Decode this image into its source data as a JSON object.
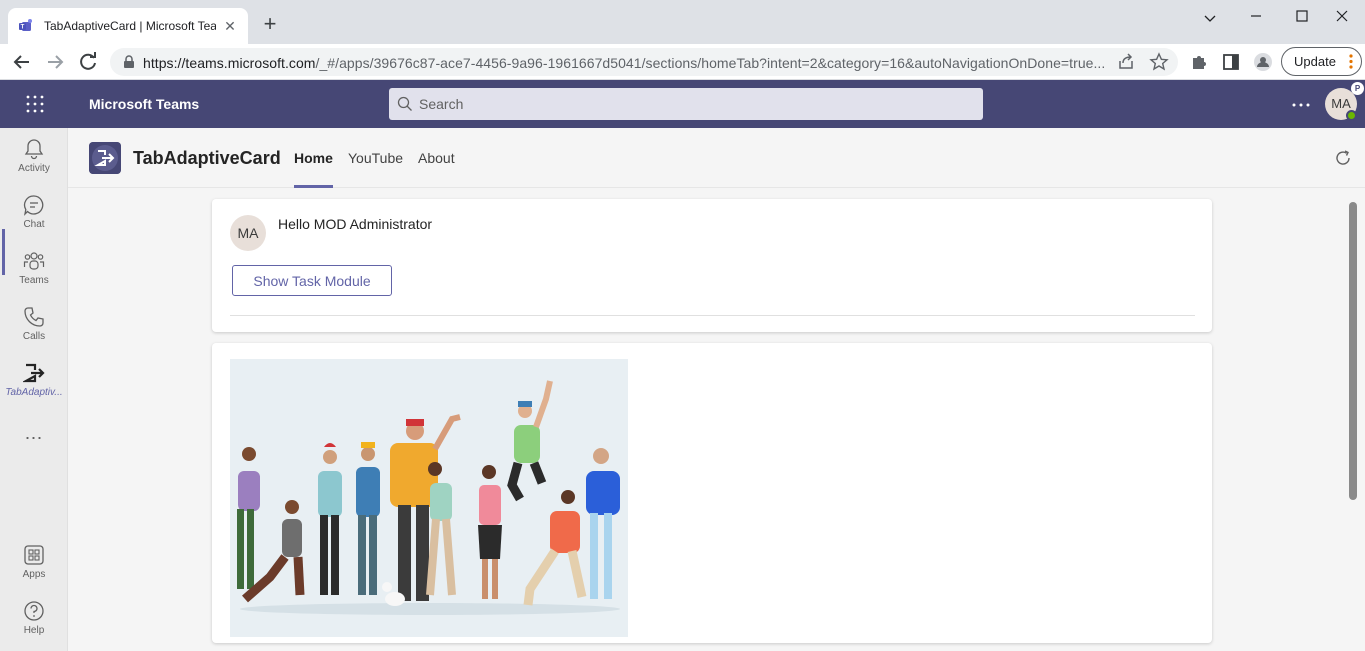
{
  "browser": {
    "tab_title": "TabAdaptiveCard | Microsoft Teams",
    "tab_close": "✕",
    "new_tab": "+",
    "url_host": "https://teams.microsoft.com",
    "url_path": "/_#/apps/39676c87-ace7-4456-9a96-1961667d5041/sections/homeTab?intent=2&category=16&autoNavigationOnDone=true...",
    "update_label": "Update"
  },
  "teams": {
    "app_name": "Microsoft Teams",
    "search_placeholder": "Search",
    "user_initials": "MA",
    "presence_badge": "P"
  },
  "rail": {
    "items": [
      {
        "label": "Activity",
        "icon": "bell-icon"
      },
      {
        "label": "Chat",
        "icon": "chat-icon"
      },
      {
        "label": "Teams",
        "icon": "teams-icon"
      },
      {
        "label": "Calls",
        "icon": "phone-icon"
      },
      {
        "label": "TabAdaptiv...",
        "icon": "app-exit-icon"
      },
      {
        "label": "Apps",
        "icon": "apps-icon"
      },
      {
        "label": "Help",
        "icon": "help-icon"
      }
    ],
    "more": "⋯"
  },
  "app": {
    "title": "TabAdaptiveCard",
    "tabs": [
      "Home",
      "YouTube",
      "About"
    ],
    "active_tab": "Home"
  },
  "card": {
    "avatar_initials": "MA",
    "greeting": "Hello MOD Administrator",
    "button_label": "Show Task Module"
  },
  "colors": {
    "brand": "#464775",
    "accent": "#6264a7",
    "presence": "#6bb700"
  }
}
